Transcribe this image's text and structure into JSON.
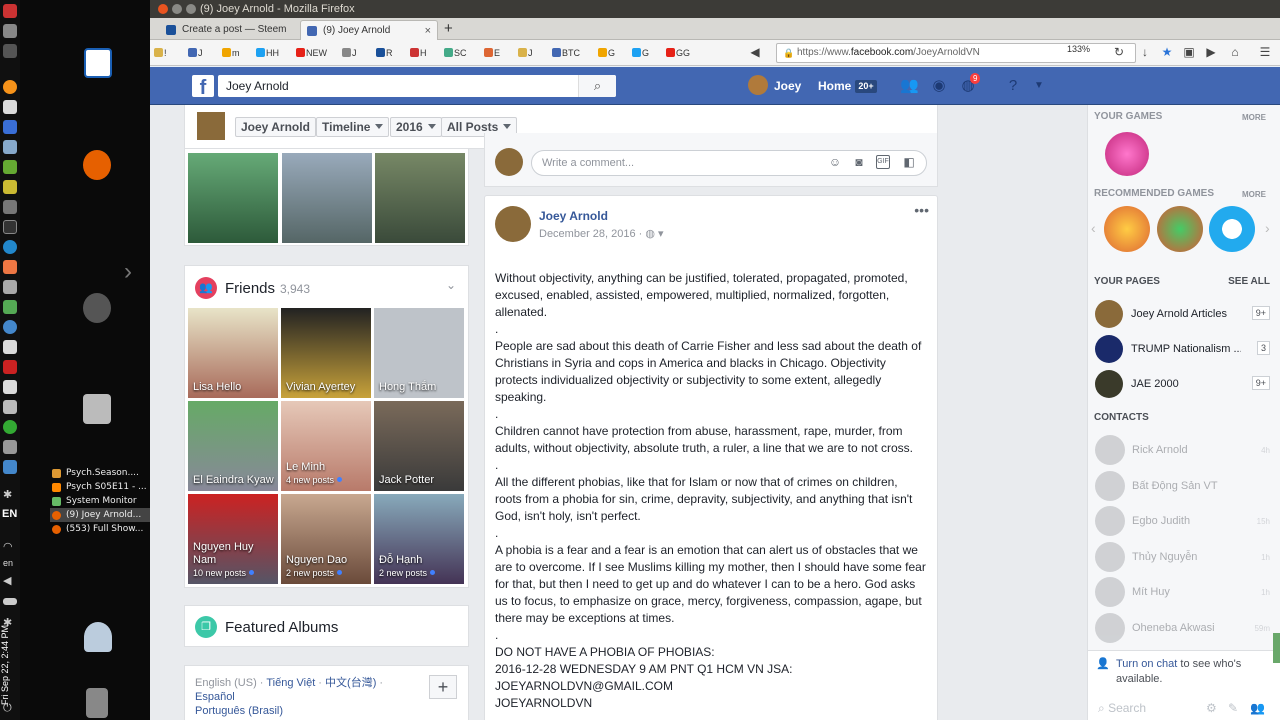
{
  "window": {
    "title": "(9) Joey Arnold - Mozilla Firefox"
  },
  "tabs": [
    {
      "label": "Create a post — Steem",
      "close": "×"
    },
    {
      "label": "(9) Joey Arnold",
      "close": "×"
    }
  ],
  "new_tab": "+",
  "bookmarks": [
    "!",
    "J",
    "m",
    "HH",
    "NEW",
    "J",
    "R",
    "H",
    "SC",
    "E",
    "J",
    "BTC",
    "G",
    "G",
    "GG"
  ],
  "url": {
    "prefix": "https://www.",
    "domain": "facebook.com",
    "path": "/JoeyArnoldVN"
  },
  "zoom": "133%",
  "taskbar": {
    "items": [
      {
        "label": "Psych.Season...."
      },
      {
        "label": "Psych S05E11 - ..."
      },
      {
        "label": "System Monitor"
      },
      {
        "label": "(9) Joey Arnold..."
      },
      {
        "label": "(553) Full Show..."
      }
    ],
    "lang": "en",
    "lang2": "EN",
    "clock": "Fri Sep 22, 2:44 PM"
  },
  "fb": {
    "logo": "f",
    "search_value": "Joey Arnold",
    "user_name": "Joey",
    "home_label": "Home",
    "home_badge": "20+",
    "notif_count": "9"
  },
  "timeline_bar": {
    "name": "Joey Arnold",
    "timeline": "Timeline",
    "year": "2016",
    "filter": "All Posts"
  },
  "friends": {
    "title": "Friends",
    "count": "3,943",
    "people": [
      {
        "name": "Lisa Hello",
        "sub": ""
      },
      {
        "name": "Vivian Ayertey",
        "sub": ""
      },
      {
        "name": "Hong Thắm",
        "sub": ""
      },
      {
        "name": "El Eaindra Kyaw",
        "sub": ""
      },
      {
        "name": "Le Minh",
        "sub": "4 new posts"
      },
      {
        "name": "Jack Potter",
        "sub": ""
      },
      {
        "name": "Nguyen Huy Nam",
        "sub": "10 new posts"
      },
      {
        "name": "Nguyen Dao",
        "sub": "2 new posts"
      },
      {
        "name": "Đỗ Hạnh",
        "sub": "2 new posts"
      }
    ]
  },
  "featured_albums": "Featured Albums",
  "languages": {
    "current": "English (US)",
    "links": [
      "Tiếng Việt",
      "中文(台灣)",
      "Español",
      "Português (Brasil)"
    ],
    "sep": " · ",
    "add": "+"
  },
  "comment_placeholder": "Write a comment...",
  "post": {
    "author": "Joey Arnold",
    "date": "December 28, 2016 · ",
    "more": "•••",
    "paragraphs": [
      "Without objectivity, anything can be justified, tolerated, propagated, promoted, excused, enabled, assisted, empowered, multiplied, normalized, forgotten, allenated.",
      ".",
      "People are sad about this death of Carrie Fisher and less sad about the death of Christians in Syria and cops in America and blacks in Chicago. Objectivity protects individualized objectivity or subjectivity to some extent, allegedly speaking.",
      ".",
      "Children cannot have protection from abuse, harassment, rape, murder, from adults, without objectivity, absolute truth, a ruler, a line that we are to not cross.",
      ".",
      "All the different phobias, like that for Islam or now that of crimes on children, roots from a phobia for sin, crime, depravity, subjectivity, and anything that isn't God, isn't holy, isn't perfect.",
      ".",
      "A phobia is a fear and a fear is an emotion that can alert us of obstacles that we are to overcome. If I see Muslims killing my mother, then I should have some fear for that, but then I need to get up and do whatever I can to be a hero. God asks us to focus, to emphasize on grace, mercy, forgiveness, compassion, agape, but there may be exceptions at times.",
      ".",
      "DO NOT HAVE A PHOBIA OF PHOBIAS:",
      "2016-12-28 WEDNESDAY 9 AM PNT Q1 HCM VN JSA:",
      "JOEYARNOLDVN@GMAIL.COM",
      "JOEYARNOLDVN"
    ]
  },
  "right": {
    "your_games": "YOUR GAMES",
    "more1": "MORE",
    "recommended_games": "RECOMMENDED GAMES",
    "more2": "MORE",
    "your_pages": "YOUR PAGES",
    "see_all": "SEE ALL",
    "pages": [
      {
        "name": "Joey Arnold Articles",
        "count": "9+"
      },
      {
        "name": "TRUMP Nationalism ...",
        "count": "3"
      },
      {
        "name": "JAE 2000",
        "count": "9+"
      }
    ],
    "contacts_title": "CONTACTS",
    "contacts": [
      {
        "name": "Rick Arnold",
        "time": "4h"
      },
      {
        "name": "Bất Động Sản VT",
        "time": ""
      },
      {
        "name": "Egbo Judith",
        "time": "15h"
      },
      {
        "name": "Thủy Nguyễn",
        "time": "1h"
      },
      {
        "name": "Mít Huy",
        "time": "1h"
      },
      {
        "name": "Oheneba Akwasi",
        "time": "59m"
      }
    ],
    "chat_link": "Turn on chat",
    "chat_rest": " to see who's available.",
    "search_placeholder": "Search"
  },
  "colors": {
    "fb_blue": "#4267b2",
    "link": "#365899",
    "titlebar": "#3c3b37"
  }
}
